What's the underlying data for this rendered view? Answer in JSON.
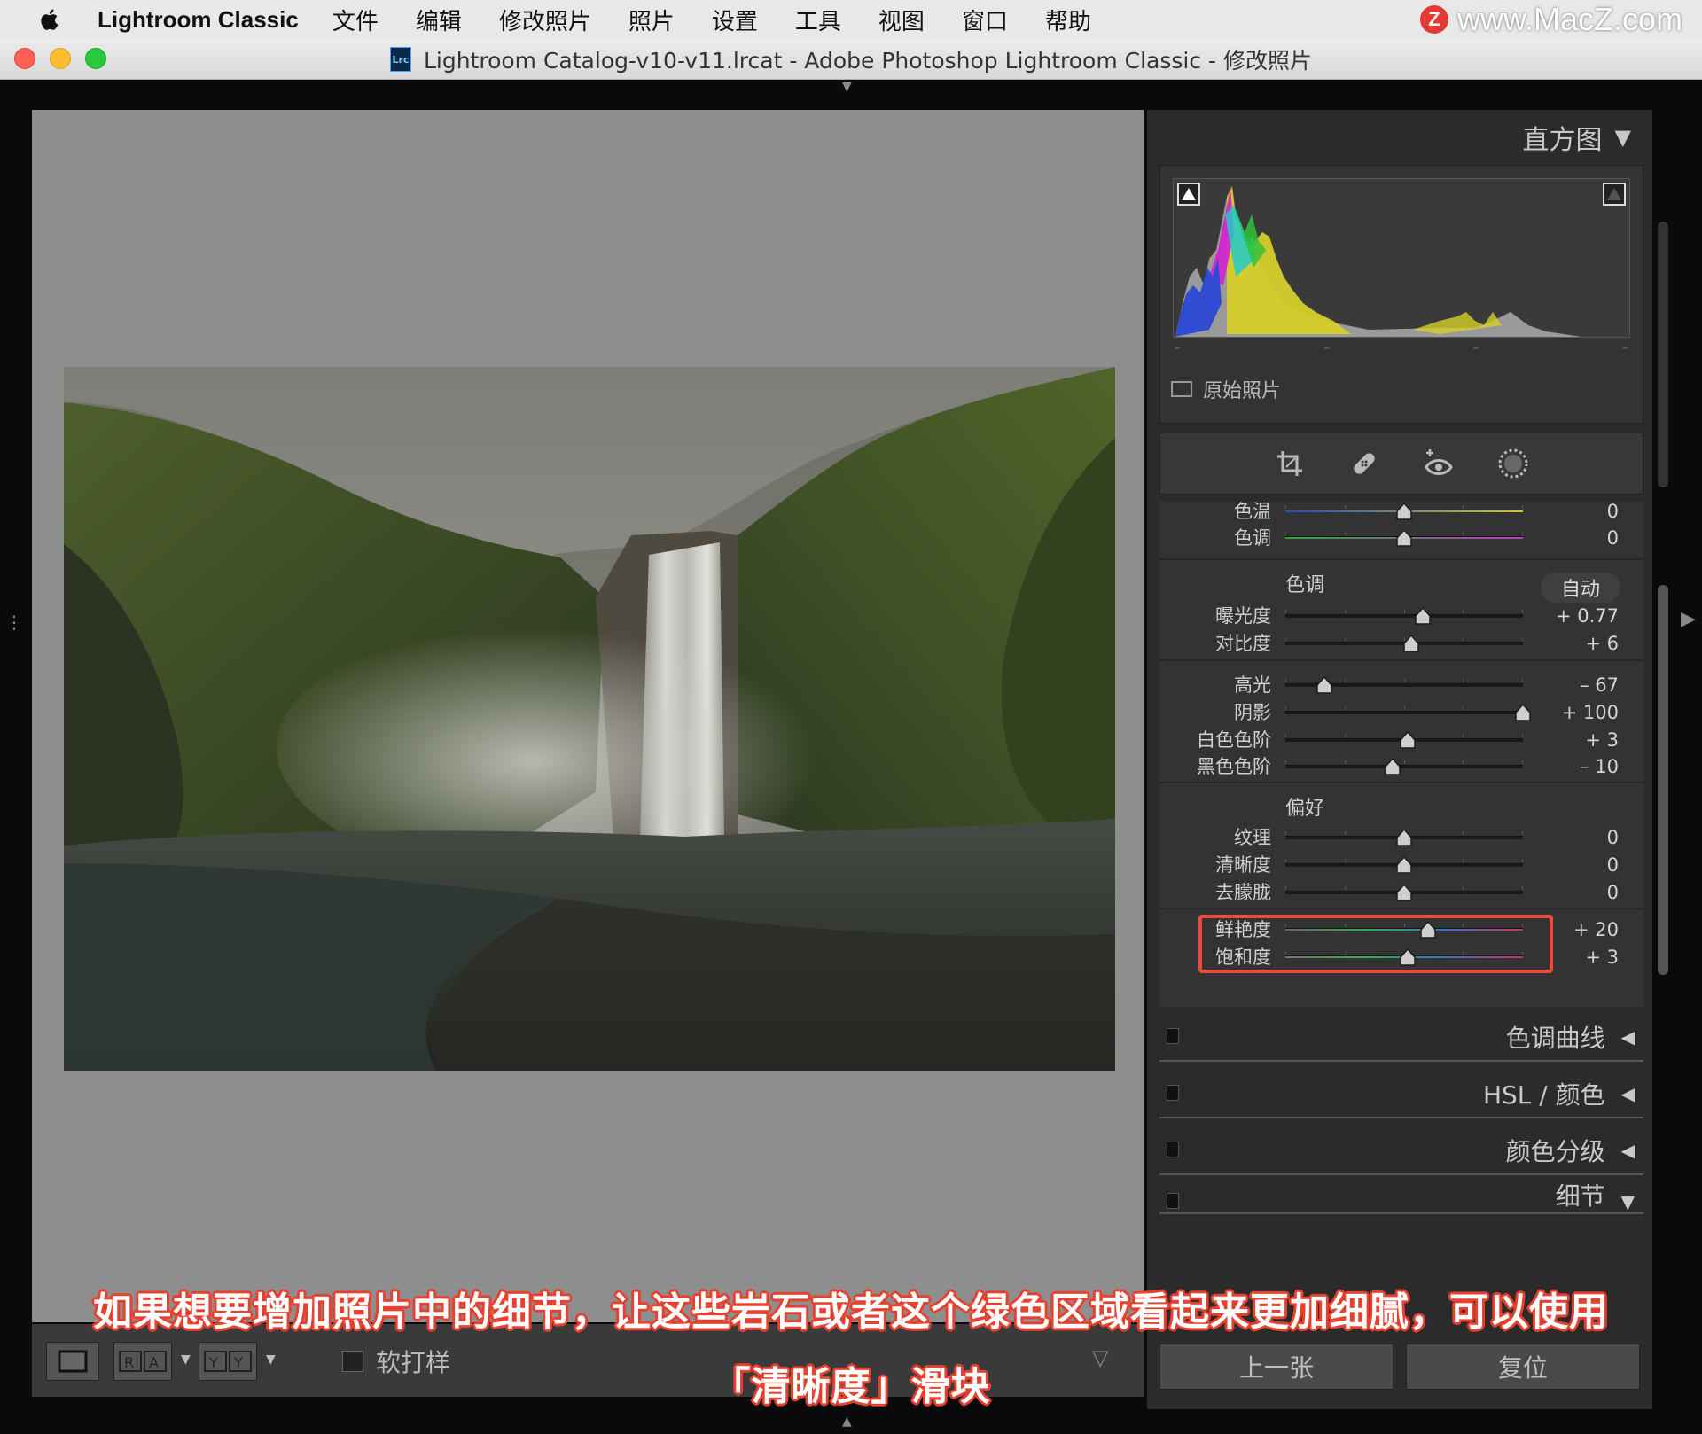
{
  "menubar": {
    "app_name": "Lightroom Classic",
    "items": [
      "文件",
      "编辑",
      "修改照片",
      "照片",
      "设置",
      "工具",
      "视图",
      "窗口",
      "帮助"
    ]
  },
  "watermark": {
    "logo": "Z",
    "text": "www.MacZ.com"
  },
  "window": {
    "icon_label": "Lrc",
    "title": "Lightroom Catalog-v10-v11.lrcat - Adobe Photoshop Lightroom Classic - 修改照片"
  },
  "histogram": {
    "title": "直方图",
    "original_photo_label": "原始照片"
  },
  "basic_panel": {
    "wb_rows": [
      {
        "label": "色温",
        "value": "0",
        "pos": 0.5
      },
      {
        "label": "色调",
        "value": "0",
        "pos": 0.5
      }
    ],
    "tone_title": "色调",
    "auto_label": "自动",
    "tone_rows": [
      {
        "label": "曝光度",
        "value": "+ 0.77",
        "pos": 0.577
      },
      {
        "label": "对比度",
        "value": "+ 6",
        "pos": 0.53
      },
      {
        "label": "高光",
        "value": "– 67",
        "pos": 0.165
      },
      {
        "label": "阴影",
        "value": "+ 100",
        "pos": 1.0
      },
      {
        "label": "白色色阶",
        "value": "+ 3",
        "pos": 0.515
      },
      {
        "label": "黑色色阶",
        "value": "– 10",
        "pos": 0.45
      }
    ],
    "presence_title": "偏好",
    "presence_rows": [
      {
        "label": "纹理",
        "value": "0",
        "pos": 0.5
      },
      {
        "label": "清晰度",
        "value": "0",
        "pos": 0.5
      },
      {
        "label": "去朦胧",
        "value": "0",
        "pos": 0.5
      },
      {
        "label": "鲜艳度",
        "value": "+ 20",
        "pos": 0.6
      },
      {
        "label": "饱和度",
        "value": "+ 3",
        "pos": 0.515
      }
    ]
  },
  "collapsed_panels": [
    {
      "label": "色调曲线"
    },
    {
      "label": "HSL / 颜色"
    },
    {
      "label": "颜色分级"
    },
    {
      "label": "细节"
    }
  ],
  "toolbar": {
    "soft_proof_label": "软打样",
    "prev_label": "上一张",
    "reset_label": "复位"
  },
  "caption": {
    "line1": "如果想要增加照片中的细节，让这些岩石或者这个绿色区域看起来更加细腻，可以使用",
    "line2": "「清晰度」滑块"
  },
  "colors": {
    "accent_highlight": "#e84a3c",
    "panel_bg": "#333333",
    "viewer_bg": "#8e8e8e"
  }
}
